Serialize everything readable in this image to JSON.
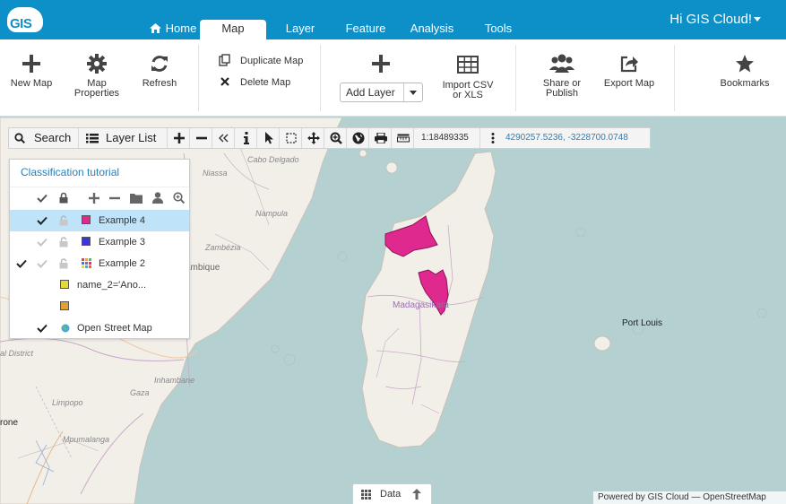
{
  "header": {
    "logo_text": "GIS",
    "greeting": "Hi GIS Cloud!",
    "tabs": [
      {
        "label": "Home"
      },
      {
        "label": "Map"
      },
      {
        "label": "Layer"
      },
      {
        "label": "Feature"
      },
      {
        "label": "Analysis"
      },
      {
        "label": "Tools"
      }
    ],
    "active_tab": "Map"
  },
  "ribbon": {
    "new_map": "New Map",
    "map_properties_1": "Map",
    "map_properties_2": "Properties",
    "refresh": "Refresh",
    "duplicate_map": "Duplicate Map",
    "delete_map": "Delete Map",
    "add_layer": "Add Layer",
    "import_1": "Import CSV",
    "import_2": "or XLS",
    "share_1": "Share or",
    "share_2": "Publish",
    "export_map": "Export Map",
    "bookmarks": "Bookmarks"
  },
  "map_toolbar": {
    "search": "Search",
    "layer_list": "Layer List",
    "scale": "1:18489335",
    "coordinates": "4290257.5236, -3228700.0748"
  },
  "layer_panel": {
    "title": "Classification tutorial",
    "layers": [
      {
        "name": "Example 4",
        "color": "#e0298e",
        "selected": true,
        "visible": true
      },
      {
        "name": "Example 3",
        "color": "#3c34d8",
        "selected": false,
        "visible": false
      },
      {
        "name": "Example 2",
        "color": "multi",
        "selected": false,
        "visible": true
      },
      {
        "name": "name_2='Ano...",
        "color": "#e7d93a"
      },
      {
        "name": "",
        "color": "#e0a13a"
      },
      {
        "name": "Open Street Map",
        "color": "globe",
        "visible": true
      }
    ]
  },
  "map_labels": {
    "niassa": "Niassa",
    "cabo_delgado": "Cabo Delgado",
    "nampula": "Nampula",
    "zambezia": "Zambézia",
    "mozambique": "ambique",
    "madagasikara": "Madagasikara",
    "port_louis": "Port Louis",
    "inhambane": "Inhambane",
    "gaza": "Gaza",
    "limpopo": "Limpopo",
    "mpumalanga": "Mpumalanga",
    "rone": "rone",
    "al_district": "al District"
  },
  "footer": {
    "data_button": "Data",
    "powered_by": "Powered by GIS Cloud — OpenStreetMap"
  },
  "colors": {
    "brand": "#0d8fc7",
    "selected_row": "#bfe3f8",
    "highlight_region": "#e0298e"
  }
}
